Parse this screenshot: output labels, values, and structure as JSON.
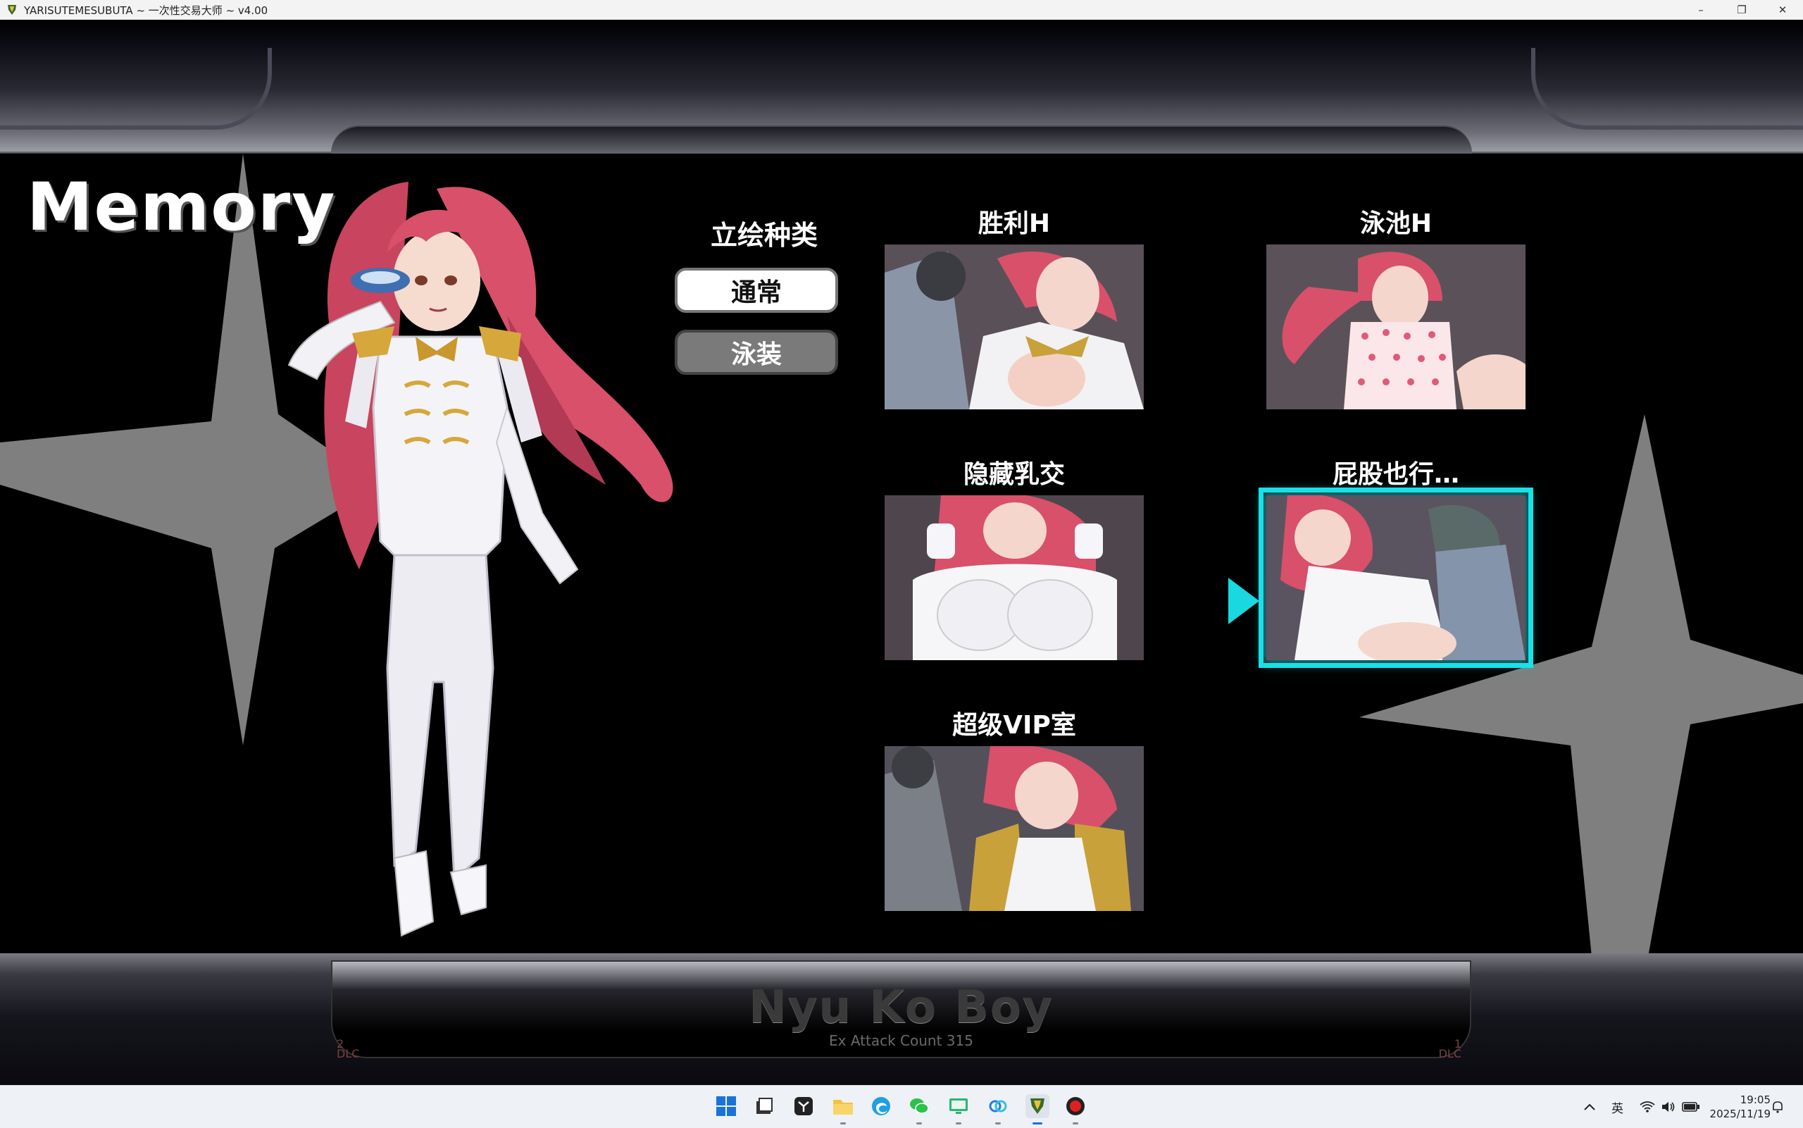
{
  "window": {
    "title": "YARISUTEMESUBUTA ~ 一次性交易大师 ~ v4.00",
    "minimize": "–",
    "maximize": "❐",
    "close": "✕"
  },
  "screen": {
    "title": "Memory",
    "pose_type_heading": "立绘种类",
    "pose_types": [
      {
        "label": "通常",
        "active": true
      },
      {
        "label": "泳装",
        "active": false
      }
    ]
  },
  "scenes": [
    {
      "label": "胜利H",
      "selected": false
    },
    {
      "label": "泳池H",
      "selected": false
    },
    {
      "label": "隐藏乳交",
      "selected": false
    },
    {
      "label": "屁股也行…",
      "selected": true
    },
    {
      "label": "超级VIP室",
      "selected": false
    }
  ],
  "footer": {
    "boy_name": "Nyu Ko Boy",
    "stats": "Ex Attack Count 315",
    "dlc_left_num": "2",
    "dlc_left_label": "DLC",
    "dlc_right_num": "1",
    "dlc_right_label": "DLC"
  },
  "taskbar": {
    "icons": [
      "windows-start-icon",
      "file-icon",
      "app-icon",
      "file-explorer-icon",
      "edge-icon",
      "wechat-icon",
      "monitor-icon",
      "cloud-app-icon",
      "game-icon",
      "record-icon"
    ],
    "ime": "英",
    "time": "19:05",
    "date": "2025/11/19"
  },
  "colors": {
    "selection": "#19e0e8",
    "hair": "#d8506a",
    "star": "#7f7f7f"
  }
}
